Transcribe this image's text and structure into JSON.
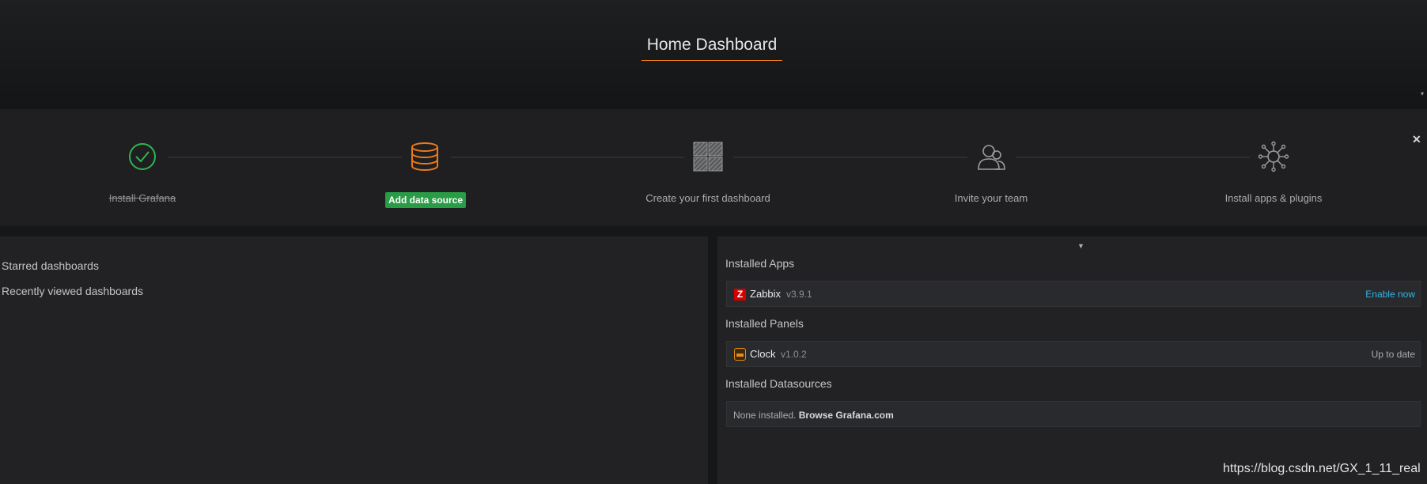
{
  "header": {
    "title": "Home Dashboard"
  },
  "onboarding": {
    "close_icon": "close-icon",
    "steps": [
      {
        "label": "Install Grafana",
        "icon": "check-circle-icon",
        "state": "done"
      },
      {
        "label": "Add data source",
        "icon": "database-icon",
        "state": "active"
      },
      {
        "label": "Create your first dashboard",
        "icon": "dashboard-grid-icon",
        "state": "todo"
      },
      {
        "label": "Invite your team",
        "icon": "users-icon",
        "state": "todo"
      },
      {
        "label": "Install apps & plugins",
        "icon": "plugins-icon",
        "state": "todo"
      }
    ]
  },
  "left": {
    "starred": "Starred dashboards",
    "recent": "Recently viewed dashboards"
  },
  "right": {
    "apps_heading": "Installed Apps",
    "apps": [
      {
        "name": "Zabbix",
        "version": "v3.9.1",
        "action": "Enable now"
      }
    ],
    "panels_heading": "Installed Panels",
    "panels": [
      {
        "name": "Clock",
        "version": "v1.0.2",
        "status": "Up to date"
      }
    ],
    "datasources_heading": "Installed Datasources",
    "datasources_empty": "None installed.",
    "datasources_link": "Browse Grafana.com"
  },
  "watermark": "https://blog.csdn.net/GX_1_11_real",
  "colors": {
    "accent": "#eb7b18",
    "success": "#299c46",
    "link": "#33b5e5",
    "zabbix": "#d40000"
  }
}
